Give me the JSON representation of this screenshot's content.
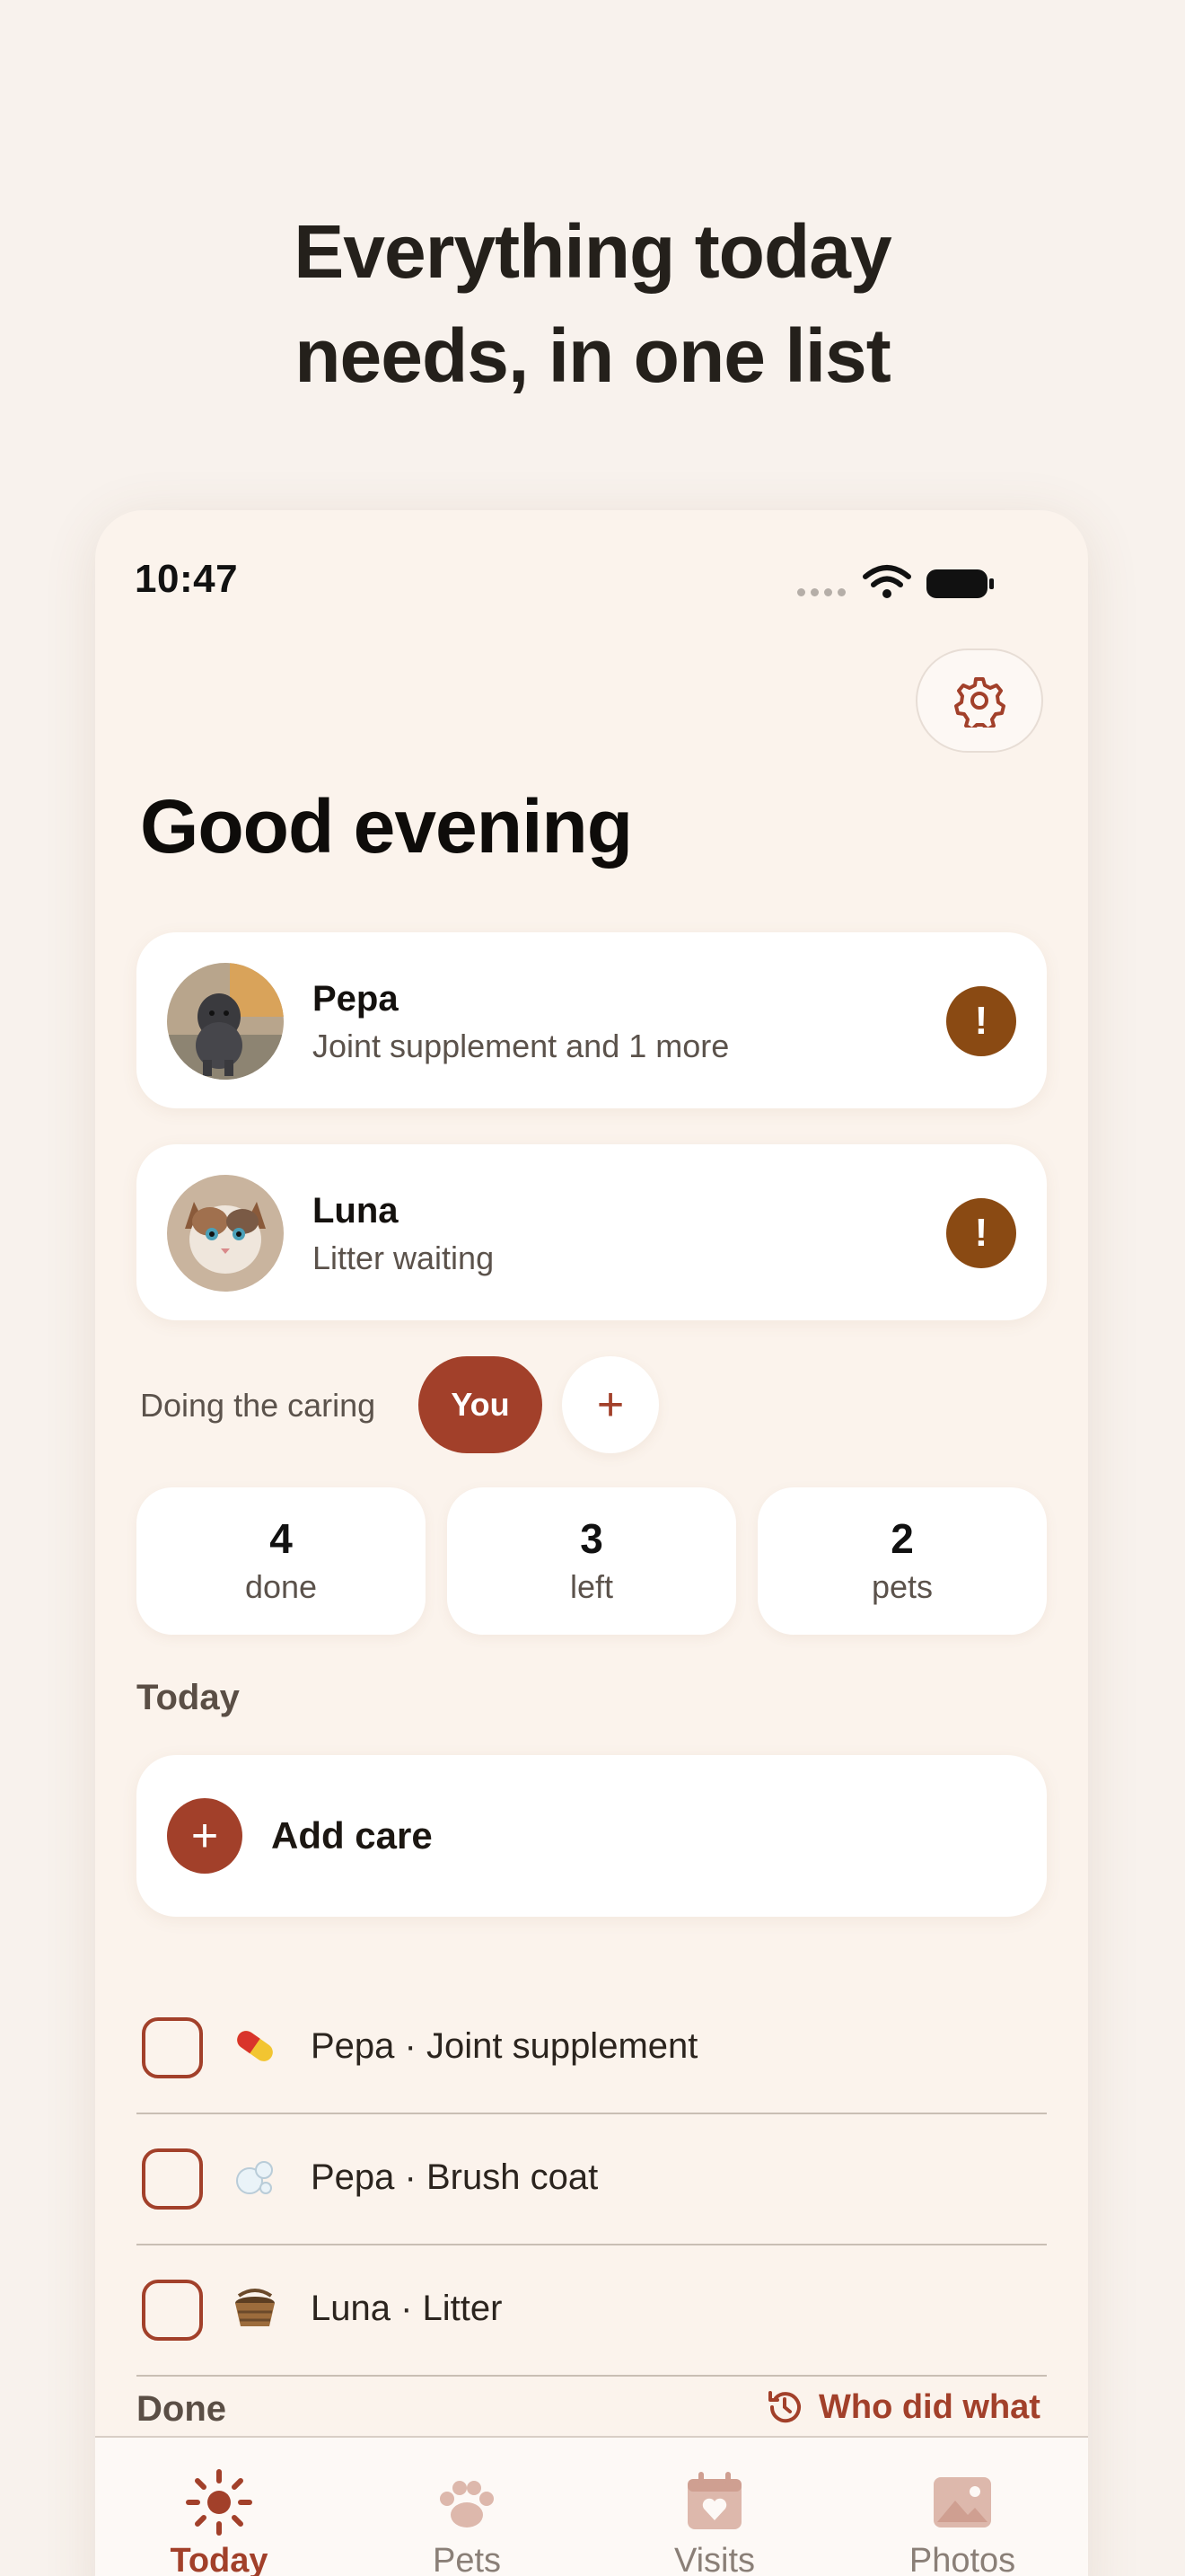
{
  "headline": {
    "line1": "Everything today",
    "line2": "needs, in one list"
  },
  "status_bar": {
    "time": "10:47"
  },
  "greeting": "Good evening",
  "pets": [
    {
      "name": "Pepa",
      "subtitle": "Joint supplement and 1 more",
      "alert": "!"
    },
    {
      "name": "Luna",
      "subtitle": "Litter waiting",
      "alert": "!"
    }
  ],
  "caregivers": {
    "label": "Doing the caring",
    "current": "You",
    "add": "+"
  },
  "stats": [
    {
      "value": "4",
      "label": "done"
    },
    {
      "value": "3",
      "label": "left"
    },
    {
      "value": "2",
      "label": "pets"
    }
  ],
  "today": {
    "title": "Today",
    "add_care": "Add care",
    "add_care_icon": "+",
    "tasks": [
      {
        "label": "Pepa · Joint supplement",
        "icon": "pill-icon"
      },
      {
        "label": "Pepa · Brush coat",
        "icon": "bubbles-icon"
      },
      {
        "label": "Luna · Litter",
        "icon": "basket-icon"
      }
    ]
  },
  "done": {
    "title": "Done",
    "history_link": "Who did what"
  },
  "tabs": [
    {
      "label": "Today",
      "icon": "sun-icon",
      "active": true
    },
    {
      "label": "Pets",
      "icon": "paw-icon",
      "active": false
    },
    {
      "label": "Visits",
      "icon": "calendar-heart-icon",
      "active": false
    },
    {
      "label": "Photos",
      "icon": "photo-icon",
      "active": false
    }
  ],
  "colors": {
    "accent": "#a2402a",
    "alert": "#8a4a13",
    "background": "#f8f2ed",
    "card": "#ffffff"
  }
}
